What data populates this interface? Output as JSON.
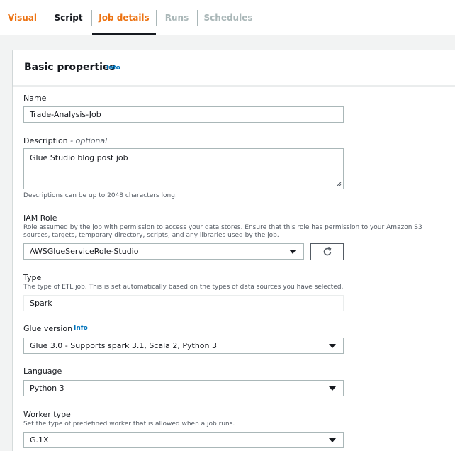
{
  "tabs": [
    {
      "label": "Visual"
    },
    {
      "label": "Script"
    },
    {
      "label": "Job details"
    },
    {
      "label": "Runs"
    },
    {
      "label": "Schedules"
    }
  ],
  "section": {
    "title": "Basic properties",
    "info": "Info"
  },
  "name": {
    "label": "Name",
    "value": "Trade-Analysis-Job"
  },
  "description": {
    "label": "Description",
    "optional": "- optional",
    "value": "Glue Studio blog post job",
    "hint": "Descriptions can be up to 2048 characters long."
  },
  "iam_role": {
    "label": "IAM Role",
    "hint": "Role assumed by the job with permission to access your data stores. Ensure that this role has permission to your Amazon S3 sources, targets, temporary directory, scripts, and any libraries used by the job.",
    "value": "AWSGlueServiceRole-Studio",
    "refresh_icon": "refresh-icon"
  },
  "type": {
    "label": "Type",
    "hint": "The type of ETL job. This is set automatically based on the types of data sources you have selected.",
    "value": "Spark"
  },
  "glue_version": {
    "label": "Glue version",
    "info": "Info",
    "value": "Glue 3.0 - Supports spark 3.1, Scala 2, Python 3"
  },
  "language": {
    "label": "Language",
    "value": "Python 3"
  },
  "worker_type": {
    "label": "Worker type",
    "hint": "Set the type of predefined worker that is allowed when a job runs.",
    "value": "G.1X"
  },
  "colors": {
    "accent": "#ec7211",
    "link": "#0073bb",
    "border": "#aab7b8"
  }
}
